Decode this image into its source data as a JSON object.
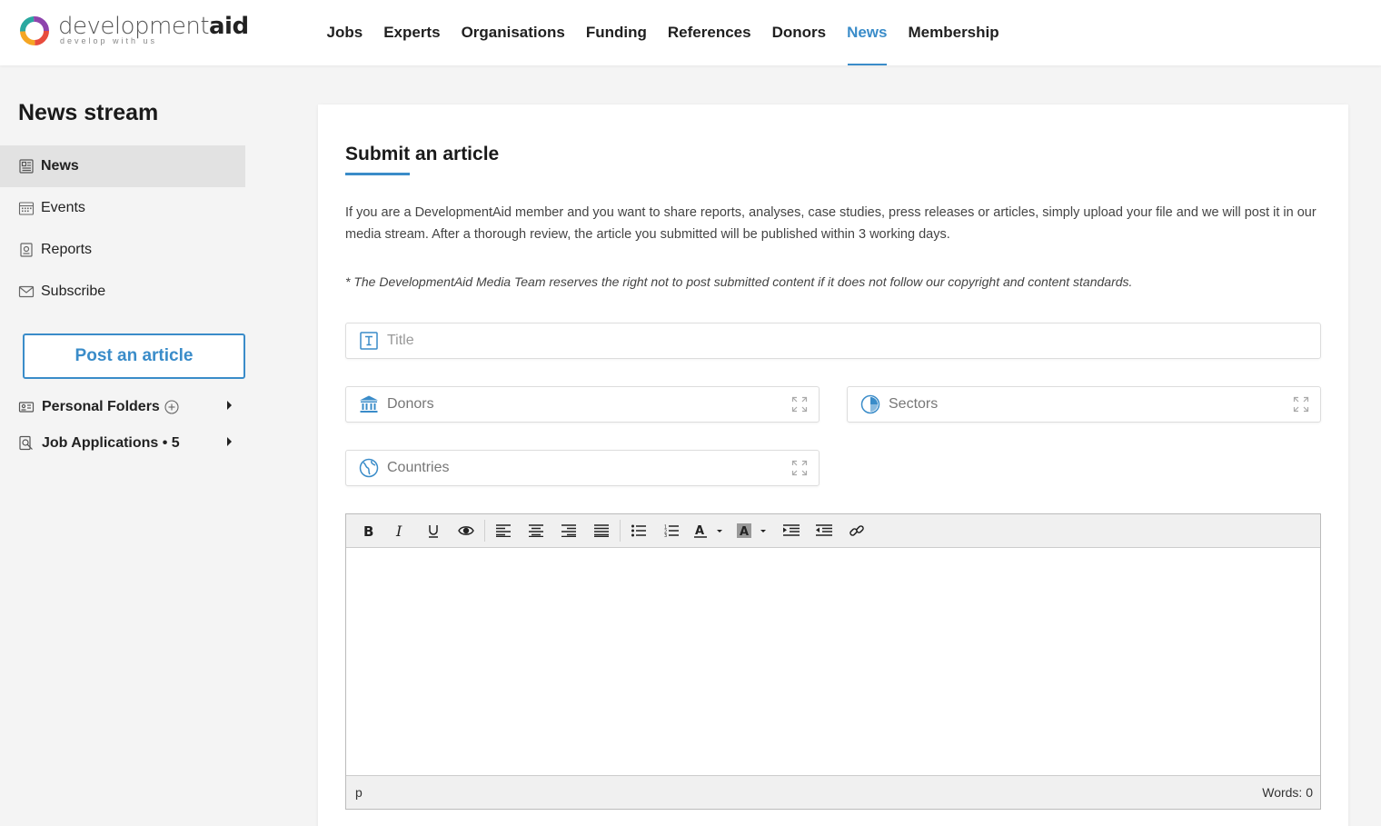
{
  "brand": {
    "name_light": "development",
    "name_bold": "aid",
    "tagline": "develop with us"
  },
  "nav": {
    "items": [
      {
        "label": "Jobs"
      },
      {
        "label": "Experts"
      },
      {
        "label": "Organisations"
      },
      {
        "label": "Funding"
      },
      {
        "label": "References"
      },
      {
        "label": "Donors"
      },
      {
        "label": "News",
        "active": true
      },
      {
        "label": "Membership"
      }
    ]
  },
  "sidebar": {
    "title": "News stream",
    "items": [
      {
        "label": "News",
        "icon": "newspaper-icon",
        "active": true
      },
      {
        "label": "Events",
        "icon": "calendar-icon"
      },
      {
        "label": "Reports",
        "icon": "report-icon"
      },
      {
        "label": "Subscribe",
        "icon": "envelope-icon"
      }
    ],
    "post_button": "Post an article",
    "personal_folders": "Personal Folders",
    "job_applications": "Job Applications • 5"
  },
  "main": {
    "title": "Submit an article",
    "intro": "If you are a DevelopmentAid member and you want to share reports, analyses, case studies, press releases or articles, simply upload your file and we will post it in our media stream. After a thorough review, the article you submitted will be published within 3 working days.",
    "note": "* The DevelopmentAid Media Team reserves the right not to post submitted content if it does not follow our copyright and content standards.",
    "fields": {
      "title_placeholder": "Title",
      "title_value": "",
      "donors": "Donors",
      "sectors": "Sectors",
      "countries": "Countries"
    },
    "editor": {
      "element_path": "p",
      "word_count": "Words: 0",
      "tools": [
        "bold",
        "italic",
        "underline",
        "preview",
        "align-left",
        "align-center",
        "align-right",
        "justify",
        "bullet-list",
        "numbered-list",
        "text-color",
        "background-color",
        "indent",
        "outdent",
        "link"
      ]
    }
  },
  "colors": {
    "accent": "#3a8cc9",
    "background": "#f4f4f4",
    "active_sidebar": "#e2e2e2"
  }
}
